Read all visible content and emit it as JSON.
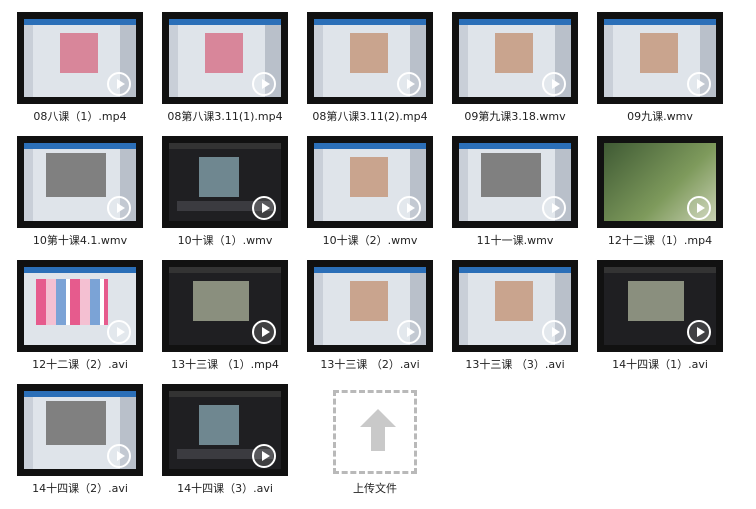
{
  "files": [
    {
      "name": "08八课（1）.mp4",
      "style": "ps-pink"
    },
    {
      "name": "08第八课3.11(1).mp4",
      "style": "ps-pink"
    },
    {
      "name": "08第八课3.11(2).mp4",
      "style": "ps-photo"
    },
    {
      "name": "09第九课3.18.wmv",
      "style": "ps-photo"
    },
    {
      "name": "09九课.wmv",
      "style": "ps-photo"
    },
    {
      "name": "10第十课4.1.wmv",
      "style": "ps-gray"
    },
    {
      "name": "10十课（1）.wmv",
      "style": "dark"
    },
    {
      "name": "10十课（2）.wmv",
      "style": "ps-photo"
    },
    {
      "name": "11十一课.wmv",
      "style": "ps-gray"
    },
    {
      "name": "12十二课（1）.mp4",
      "style": "tree"
    },
    {
      "name": "12十二课（2）.avi",
      "style": "web-grid"
    },
    {
      "name": "13十三课 （1）.mp4",
      "style": "dark-photo"
    },
    {
      "name": "13十三课 （2）.avi",
      "style": "ps-photo"
    },
    {
      "name": "13十三课 （3）.avi",
      "style": "ps-photo"
    },
    {
      "name": "14十四课（1）.avi",
      "style": "dark-photo"
    },
    {
      "name": "14十四课（2）.avi",
      "style": "ps-gray"
    },
    {
      "name": "14十四课（3）.avi",
      "style": "dark"
    }
  ],
  "upload": {
    "label": "上传文件"
  },
  "colors": {
    "accent": "#2b6fb8",
    "upload_border": "#b9b9b9"
  }
}
